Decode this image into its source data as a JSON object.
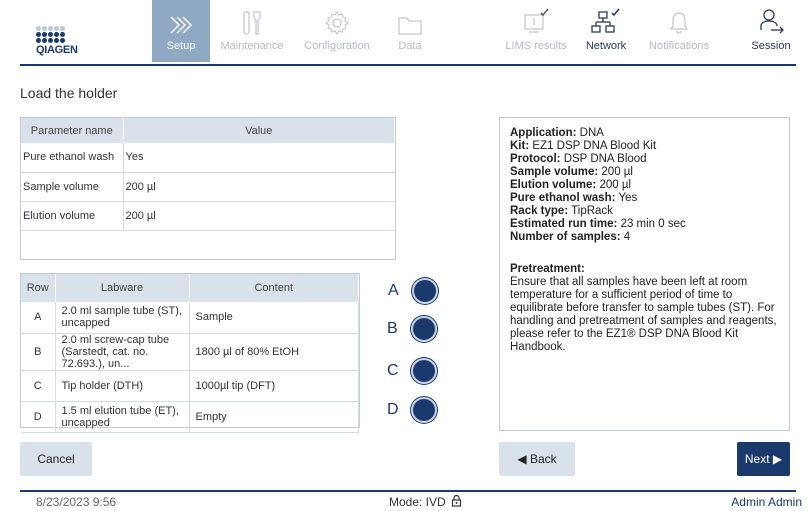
{
  "header": {
    "logo_text": "QIAGEN",
    "tabs": [
      {
        "label": "Setup",
        "icon": "chevrons-right-icon",
        "active": true
      },
      {
        "label": "Maintenance",
        "icon": "tools-icon",
        "active": false
      },
      {
        "label": "Configuration",
        "icon": "gear-icon",
        "active": false
      },
      {
        "label": "Data",
        "icon": "folder-icon",
        "active": false
      },
      {
        "label": "LIMS results",
        "icon": "lims-icon",
        "active": false
      },
      {
        "label": "Network",
        "icon": "network-icon",
        "active": false
      },
      {
        "label": "Notifications",
        "icon": "bell-icon",
        "active": false
      },
      {
        "label": "Session",
        "icon": "user-logout-icon",
        "active": false
      }
    ]
  },
  "page_title": "Load the holder",
  "param_table": {
    "headers": [
      "Parameter name",
      "Value"
    ],
    "rows": [
      [
        "Pure ethanol wash",
        "Yes"
      ],
      [
        "Sample volume",
        "200 µl"
      ],
      [
        "Elution volume",
        "200 µl"
      ]
    ]
  },
  "labware_table": {
    "headers": [
      "Row",
      "Labware",
      "Content"
    ],
    "rows": [
      [
        "A",
        "2.0 ml sample tube (ST), uncapped",
        "Sample"
      ],
      [
        "B",
        "2.0 ml screw-cap tube (Sarstedt, cat. no. 72.693.), un...",
        "1800 µl of 80% EtOH"
      ],
      [
        "C",
        "Tip holder (DTH)",
        "1000µl tip (DFT)"
      ],
      [
        "D",
        "1.5 ml elution tube (ET), uncapped",
        "Empty"
      ]
    ]
  },
  "positions": [
    "A",
    "B",
    "C",
    "D"
  ],
  "info": {
    "lines": [
      {
        "label": "Application:",
        "value": "DNA"
      },
      {
        "label": "Kit:",
        "value": "EZ1 DSP DNA Blood Kit"
      },
      {
        "label": "Protocol:",
        "value": "DSP DNA Blood"
      },
      {
        "label": "Sample volume:",
        "value": "200 µl"
      },
      {
        "label": "Elution volume:",
        "value": "200 µl"
      },
      {
        "label": "Pure ethanol wash:",
        "value": "Yes"
      },
      {
        "label": "Rack type:",
        "value": "TipRack"
      },
      {
        "label": "Estimated run time:",
        "value": "23 min 0 sec"
      },
      {
        "label": "Number of samples:",
        "value": "4"
      }
    ],
    "pretreatment_title": "Pretreatment:",
    "pretreatment_text": "Ensure that all samples have been left at room temperature for a sufficient period of time to equilibrate before transfer to sample tubes (ST). For handling and pretreatment of samples and reagents, please refer to the EZ1® DSP DNA Blood Kit Handbook."
  },
  "buttons": {
    "cancel": "Cancel",
    "back": "◀ Back",
    "next": "Next ▶"
  },
  "status": {
    "datetime": "8/23/2023 9:56",
    "mode": "Mode: IVD",
    "user": "Admin Admin"
  }
}
